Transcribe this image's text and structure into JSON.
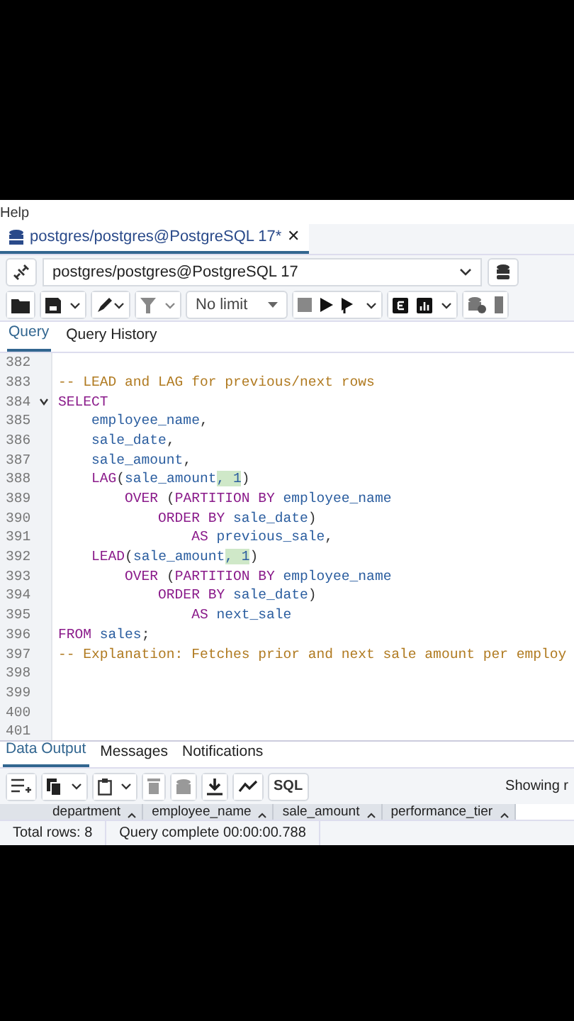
{
  "menu": {
    "items": [
      "Help"
    ]
  },
  "document_tabs": [
    {
      "label": "postgres/postgres@PostgreSQL 17*",
      "selected": true,
      "close": "✕"
    }
  ],
  "connection": {
    "value": "postgres/postgres@PostgreSQL 17"
  },
  "toolbar": {
    "limit": "No limit"
  },
  "query_tabs": [
    {
      "label": "Query",
      "selected": true
    },
    {
      "label": "Query History",
      "selected": false
    }
  ],
  "editor": {
    "lines": [
      {
        "number": "382"
      },
      {
        "number": "383",
        "tokens": [
          {
            "kind": "comment",
            "text": "-- LEAD and LAG for previous/next rows"
          }
        ]
      },
      {
        "number": "384",
        "expanded": true,
        "tokens": [
          {
            "kind": "keyword",
            "text": "SELECT"
          }
        ]
      },
      {
        "number": "385",
        "tokens": [
          {
            "kind": "identifier",
            "text": "    employee_name"
          },
          {
            "kind": "plain",
            "text": ","
          }
        ]
      },
      {
        "number": "386",
        "tokens": [
          {
            "kind": "identifier",
            "text": "    sale_date"
          },
          {
            "kind": "plain",
            "text": ","
          }
        ]
      },
      {
        "number": "387",
        "tokens": [
          {
            "kind": "identifier",
            "text": "    sale_amount"
          },
          {
            "kind": "plain",
            "text": ","
          }
        ]
      },
      {
        "number": "388",
        "tokens": [
          {
            "kind": "keyword",
            "text": "    LAG"
          },
          {
            "kind": "plain",
            "text": "("
          },
          {
            "kind": "identifier",
            "text": "sale_amount"
          },
          {
            "kind": "match",
            "text": ", 1"
          },
          {
            "kind": "plain",
            "text": ")"
          }
        ]
      },
      {
        "number": "389",
        "tokens": [
          {
            "kind": "keyword",
            "text": "        OVER"
          },
          {
            "kind": "plain",
            "text": " ("
          },
          {
            "kind": "keyword",
            "text": "PARTITION BY"
          },
          {
            "kind": "identifier",
            "text": " employee_name"
          }
        ]
      },
      {
        "number": "390",
        "tokens": [
          {
            "kind": "keyword",
            "text": "            ORDER BY"
          },
          {
            "kind": "identifier",
            "text": " sale_date"
          },
          {
            "kind": "plain",
            "text": ")"
          }
        ]
      },
      {
        "number": "391",
        "tokens": [
          {
            "kind": "keyword",
            "text": "                AS"
          },
          {
            "kind": "identifier",
            "text": " previous_sale"
          },
          {
            "kind": "plain",
            "text": ","
          }
        ]
      },
      {
        "number": "392",
        "tokens": [
          {
            "kind": "keyword",
            "text": "    LEAD"
          },
          {
            "kind": "plain",
            "text": "("
          },
          {
            "kind": "identifier",
            "text": "sale_amount"
          },
          {
            "kind": "match",
            "text": ", 1"
          },
          {
            "kind": "plain",
            "text": ")"
          }
        ]
      },
      {
        "number": "393",
        "tokens": [
          {
            "kind": "keyword",
            "text": "        OVER"
          },
          {
            "kind": "plain",
            "text": " ("
          },
          {
            "kind": "keyword",
            "text": "PARTITION BY"
          },
          {
            "kind": "identifier",
            "text": " employee_name"
          }
        ]
      },
      {
        "number": "394",
        "tokens": [
          {
            "kind": "keyword",
            "text": "            ORDER BY"
          },
          {
            "kind": "identifier",
            "text": " sale_date"
          },
          {
            "kind": "plain",
            "text": ")"
          }
        ]
      },
      {
        "number": "395",
        "tokens": [
          {
            "kind": "keyword",
            "text": "                AS"
          },
          {
            "kind": "identifier",
            "text": " next_sale"
          }
        ]
      },
      {
        "number": "396",
        "tokens": [
          {
            "kind": "keyword",
            "text": "FROM"
          },
          {
            "kind": "identifier",
            "text": " sales"
          },
          {
            "kind": "plain",
            "text": ";"
          }
        ]
      },
      {
        "number": "397",
        "tokens": [
          {
            "kind": "comment",
            "text": "-- Explanation: Fetches prior and next sale amount per employ"
          }
        ]
      },
      {
        "number": "398"
      },
      {
        "number": "399"
      },
      {
        "number": "400"
      },
      {
        "number": "401"
      }
    ]
  },
  "output_tabs": [
    {
      "label": "Data Output",
      "selected": true
    },
    {
      "label": "Messages",
      "selected": false
    },
    {
      "label": "Notifications",
      "selected": false
    }
  ],
  "output_toolbar": {
    "sql_button": "SQL",
    "showing": "Showing r"
  },
  "grid": {
    "columns": [
      "department",
      "employee_name",
      "sale_amount",
      "performance_tier"
    ]
  },
  "status_bar": {
    "total_rows": "Total rows: 8",
    "query_status": "Query complete 00:00:00.788"
  }
}
